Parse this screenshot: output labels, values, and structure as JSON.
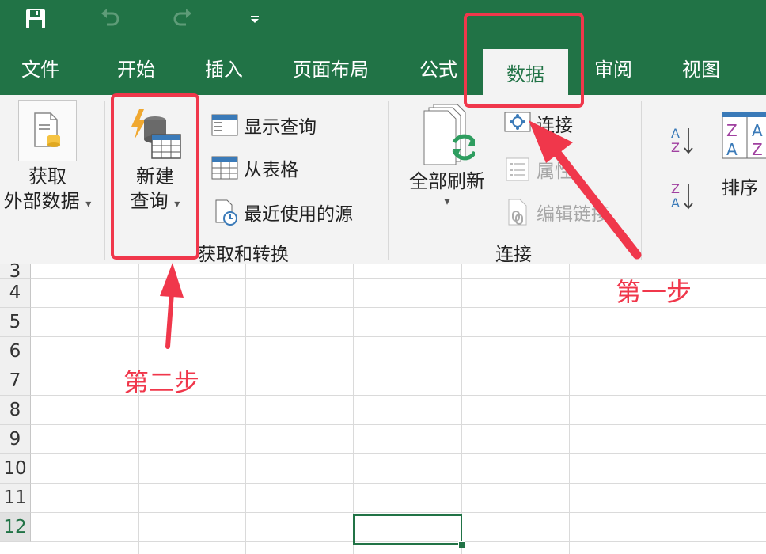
{
  "quick_access": {
    "save_icon": "save-icon",
    "undo_icon": "undo-icon",
    "redo_icon": "redo-icon",
    "customize_icon": "customize-dropdown-icon"
  },
  "tabs": [
    {
      "label": "文件"
    },
    {
      "label": "开始"
    },
    {
      "label": "插入"
    },
    {
      "label": "页面布局"
    },
    {
      "label": "公式"
    },
    {
      "label": "数据",
      "active": true
    },
    {
      "label": "审阅"
    },
    {
      "label": "视图"
    }
  ],
  "ribbon": {
    "external_data": {
      "line1": "获取",
      "line2": "外部数据"
    },
    "get_transform": {
      "new_query": {
        "line1": "新建",
        "line2": "查询"
      },
      "show_queries": "显示查询",
      "from_table": "从表格",
      "recent_sources": "最近使用的源",
      "group_label": "获取和转换"
    },
    "connections": {
      "refresh_all": "全部刷新",
      "connections": "连接",
      "properties": "属性",
      "edit_links": "编辑链接",
      "group_label": "连接"
    },
    "sort": {
      "label": "排序"
    }
  },
  "grid": {
    "rows": [
      "3",
      "4",
      "5",
      "6",
      "7",
      "8",
      "9",
      "10",
      "11",
      "12"
    ],
    "selected_row": "12"
  },
  "annotations": {
    "step1": "第一步",
    "step2": "第二步"
  },
  "colors": {
    "brand": "#217346",
    "annotation": "#f0374b"
  }
}
